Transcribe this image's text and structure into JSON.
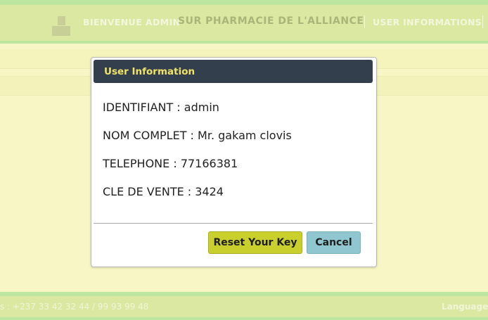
{
  "header": {
    "welcome": "BIENVENUE ADMIN",
    "pharmacy": "SUR PHARMACIE DE L'ALLIANCE",
    "user_informations": "USER INFORMATIONS",
    "avatar_icon": "user-silhouette-icon"
  },
  "footer": {
    "contact": "s : +237 33 42 32 44 / 99 93 99 48",
    "language": "Language"
  },
  "modal": {
    "title": "User Information",
    "lines": [
      "IDENTIFIANT : admin",
      "NOM COMPLET : Mr. gakam clovis",
      "TELEPHONE : 77166381",
      "CLE DE VENTE : 3424"
    ],
    "reset_label": "Reset Your Key",
    "cancel_label": "Cancel"
  },
  "colors": {
    "header_bg": "#dbe8a2",
    "modal_header_bg": "#333f4d",
    "modal_title": "#f0e36a",
    "reset_button": "#c9d02e",
    "cancel_button": "#8fc6cf",
    "page_bg": "#f8f6c4"
  }
}
